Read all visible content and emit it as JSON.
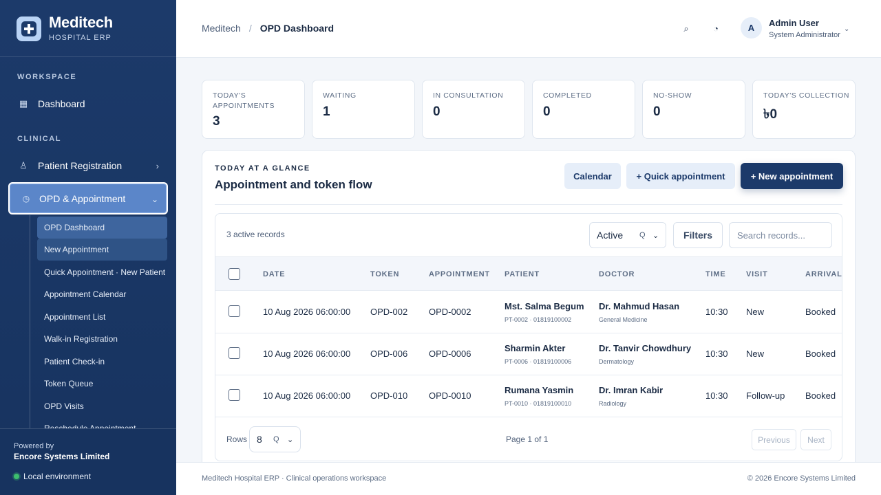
{
  "brand": {
    "name": "Meditech",
    "subtitle": "HOSPITAL ERP"
  },
  "sidebar": {
    "sections": [
      "WORKSPACE",
      "CLINICAL"
    ],
    "items": [
      {
        "label": "Dashboard",
        "icon": "grid-icon"
      },
      {
        "label": "Patient Registration",
        "icon": "person-icon"
      },
      {
        "label": "OPD & Appointment",
        "icon": "clock-icon"
      }
    ],
    "sub_items": [
      "OPD Dashboard",
      "New Appointment",
      "Quick Appointment · New Patient",
      "Appointment Calendar",
      "Appointment List",
      "Walk-in Registration",
      "Patient Check-in",
      "Token Queue",
      "OPD Visits",
      "Reschedule Appointment"
    ],
    "footer": {
      "powered_by": "Powered by",
      "company": "Encore Systems Limited",
      "environment": "Local environment"
    }
  },
  "header": {
    "breadcrumb_root": "Meditech",
    "breadcrumb_sep": "/",
    "breadcrumb_current": "OPD Dashboard",
    "search_icon": "⌕",
    "theme_icon": "◔",
    "user": {
      "initial": "A",
      "name": "Admin User",
      "role": "System Administrator",
      "chevron": "⌄"
    }
  },
  "stats": [
    {
      "label": "TODAY'S APPOINTMENTS",
      "value": "3"
    },
    {
      "label": "WAITING",
      "value": "1"
    },
    {
      "label": "IN CONSULTATION",
      "value": "0"
    },
    {
      "label": "COMPLETED",
      "value": "0"
    },
    {
      "label": "NO-SHOW",
      "value": "0"
    },
    {
      "label": "TODAY'S COLLECTION",
      "value": "৳0"
    }
  ],
  "panel": {
    "eyebrow": "TODAY AT A GLANCE",
    "title": "Appointment and token flow",
    "buttons": {
      "calendar": "Calendar",
      "quick": "+ Quick appointment",
      "new": "+ New appointment"
    }
  },
  "table": {
    "records_text": "3 active records",
    "status_filter": "Active",
    "filters_label": "Filters",
    "search_placeholder": "Search records...",
    "columns": [
      "DATE",
      "TOKEN",
      "APPOINTMENT",
      "PATIENT",
      "DOCTOR",
      "TIME",
      "VISIT",
      "ARRIVAL"
    ],
    "rows": [
      {
        "date": "10 Aug 2026 06:00:00",
        "token": "OPD-002",
        "appointment": "OPD-0002",
        "patient": "Mst. Salma Begum",
        "patient_meta": "PT-0002 · 01819100002",
        "doctor": "Dr. Mahmud Hasan",
        "department": "General Medicine",
        "time": "10:30",
        "visit": "New",
        "arrival": "Booked"
      },
      {
        "date": "10 Aug 2026 06:00:00",
        "token": "OPD-006",
        "appointment": "OPD-0006",
        "patient": "Sharmin Akter",
        "patient_meta": "PT-0006 · 01819100006",
        "doctor": "Dr. Tanvir Chowdhury",
        "department": "Dermatology",
        "time": "10:30",
        "visit": "New",
        "arrival": "Booked"
      },
      {
        "date": "10 Aug 2026 06:00:00",
        "token": "OPD-010",
        "appointment": "OPD-0010",
        "patient": "Rumana Yasmin",
        "patient_meta": "PT-0010 · 01819100010",
        "doctor": "Dr. Imran Kabir",
        "department": "Radiology",
        "time": "10:30",
        "visit": "Follow-up",
        "arrival": "Booked"
      }
    ],
    "rows_label": "Rows",
    "rows_per_page": "8",
    "page_info": "Page 1 of 1",
    "prev_label": "Previous",
    "next_label": "Next"
  },
  "footer": {
    "left": "Meditech Hospital ERP · Clinical operations workspace",
    "right": "© 2026 Encore Systems Limited"
  }
}
